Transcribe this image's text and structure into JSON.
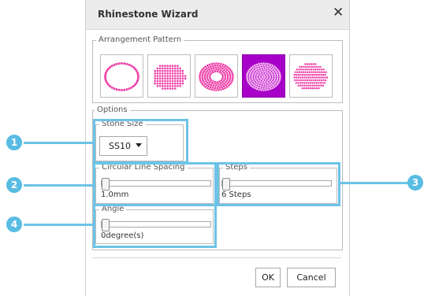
{
  "dialog": {
    "title": "Rhinestone Wizard",
    "close_icon": "close-icon"
  },
  "arrangement": {
    "label": "Arrangement Pattern",
    "patterns": [
      {
        "name": "outline-ring",
        "selected": false
      },
      {
        "name": "filled-grid",
        "selected": false
      },
      {
        "name": "concentric-ring",
        "selected": false
      },
      {
        "name": "concentric-fill",
        "selected": true
      },
      {
        "name": "stripes",
        "selected": false
      }
    ]
  },
  "options": {
    "label": "Options",
    "stone_size": {
      "label": "Stone Size",
      "value": "SS10"
    },
    "circular_line_spacing": {
      "label": "Circular Line Spacing",
      "value_text": "1.0mm",
      "level": 0
    },
    "steps": {
      "label": "Steps",
      "value_text": "6 Steps",
      "level": 0
    },
    "angle": {
      "label": "Angle",
      "value_text": "0degree(s)",
      "level": 0
    }
  },
  "callouts": [
    "1",
    "2",
    "3",
    "4"
  ],
  "buttons": {
    "ok": "OK",
    "cancel": "Cancel"
  },
  "colors": {
    "accent": "#6cc3e7",
    "badge": "#59bce3",
    "selected": "#a700c8",
    "dots": "#ee3fa8"
  }
}
